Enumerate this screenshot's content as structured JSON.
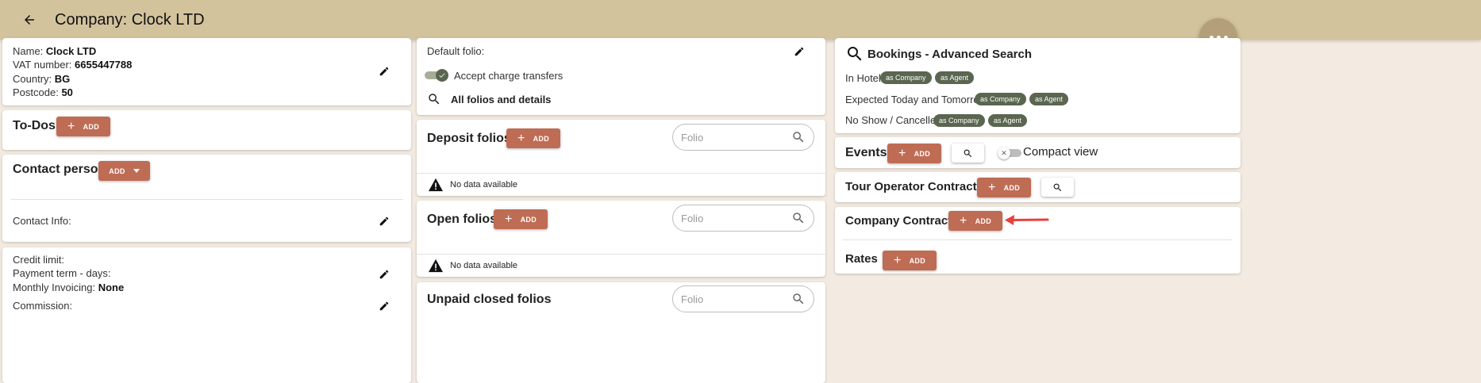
{
  "header": {
    "title": "Company: Clock LTD"
  },
  "company_info": {
    "name_label": "Name:",
    "name_value": "Clock LTD",
    "vat_label": "VAT number:",
    "vat_value": "6655447788",
    "country_label": "Country:",
    "country_value": "BG",
    "postcode_label": "Postcode:",
    "postcode_value": "50"
  },
  "todos": {
    "title": "To-Dos",
    "add_label": "ADD"
  },
  "contact_person": {
    "title": "Contact person",
    "add_label": "ADD",
    "info_label": "Contact Info:"
  },
  "billing": {
    "credit_limit_label": "Credit limit:",
    "payment_term_label": "Payment term - days:",
    "monthly_invoicing_label": "Monthly Invoicing:",
    "monthly_invoicing_value": "None",
    "commission_label": "Commission:"
  },
  "folios_settings": {
    "default_folio_label": "Default folio:",
    "accept_transfers_label": "Accept charge transfers",
    "accept_transfers_on": true,
    "all_folios_label": "All folios and details"
  },
  "deposit_folios": {
    "title": "Deposit folios",
    "add_label": "ADD",
    "search_placeholder": "Folio",
    "empty_text": "No data available"
  },
  "open_folios": {
    "title": "Open folios",
    "add_label": "ADD",
    "search_placeholder": "Folio",
    "empty_text": "No data available"
  },
  "unpaid_closed_folios": {
    "title": "Unpaid closed folios",
    "search_placeholder": "Folio"
  },
  "bookings_search": {
    "title": "Bookings - Advanced Search",
    "rows": [
      {
        "label": "In Hotel",
        "chip1": "as Company",
        "chip2": "as Agent"
      },
      {
        "label": "Expected Today and Tomorrow",
        "chip1": "as Company",
        "chip2": "as Agent"
      },
      {
        "label": "No Show / Cancelled",
        "chip1": "as Company",
        "chip2": "as Agent"
      }
    ]
  },
  "events": {
    "title": "Events",
    "add_label": "ADD",
    "compact_view_label": "Compact view",
    "compact_view_on": false
  },
  "tour_operator_contracts": {
    "title": "Tour Operator Contracts",
    "add_label": "ADD"
  },
  "company_contract": {
    "title": "Company Contract",
    "add_label": "ADD"
  },
  "rates": {
    "title": "Rates",
    "add_label": "ADD"
  },
  "colors": {
    "topbar": "#d3c39d",
    "accent": "#bf6c54",
    "chip": "#5a6650",
    "background": "#f3ebe1",
    "annotation_arrow": "#e8413c",
    "fab": "#b3a07a"
  },
  "icons": [
    "arrow-back-icon",
    "pencil-icon",
    "search-icon",
    "warning-icon",
    "more-horizontal-icon"
  ]
}
